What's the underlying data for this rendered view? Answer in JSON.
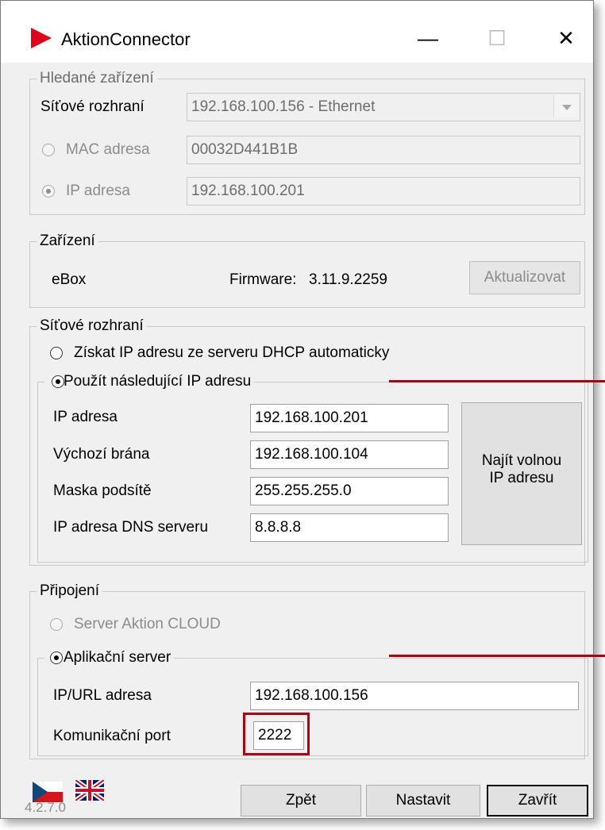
{
  "window": {
    "title": "AktionConnector",
    "minimize": "—",
    "maximize": "☐",
    "close": "✕"
  },
  "searched": {
    "group_title": "Hledané zařízení",
    "network_label": "Síťové rozhraní",
    "network_value": "192.168.100.156 - Ethernet",
    "mac_label": "MAC adresa",
    "mac_value": "00032D441B1B",
    "ip_label": "IP adresa",
    "ip_value": "192.168.100.201"
  },
  "device": {
    "group_title": "Zařízení",
    "name": "eBox",
    "firmware_label": "Firmware:",
    "firmware_value": "3.11.9.2259",
    "update_button": "Aktualizovat"
  },
  "network": {
    "group_title": "Síťové rozhraní",
    "dhcp_label": "Získat IP adresu ze serveru DHCP automaticky",
    "static_label": "Použít následující IP adresu",
    "ip_label": "IP adresa",
    "ip_value": "192.168.100.201",
    "gateway_label": "Výchozí brána",
    "gateway_value": "192.168.100.104",
    "mask_label": "Maska podsítě",
    "mask_value": "255.255.255.0",
    "dns_label": "IP adresa DNS serveru",
    "dns_value": "8.8.8.8",
    "find_button_line1": "Najít volnou",
    "find_button_line2": "IP adresu"
  },
  "connection": {
    "group_title": "Připojení",
    "cloud_label": "Server Aktion CLOUD",
    "app_label": "Aplikační server",
    "url_label": "IP/URL adresa",
    "url_value": "192.168.100.156",
    "port_label": "Komunikační port",
    "port_value": "2222"
  },
  "footer": {
    "version": "4.2.7.0",
    "back_button": "Zpět",
    "set_button": "Nastavit",
    "close_button": "Zavřít"
  },
  "colors": {
    "annotation_red": "#b00010",
    "app_icon_red": "#e0001a"
  }
}
